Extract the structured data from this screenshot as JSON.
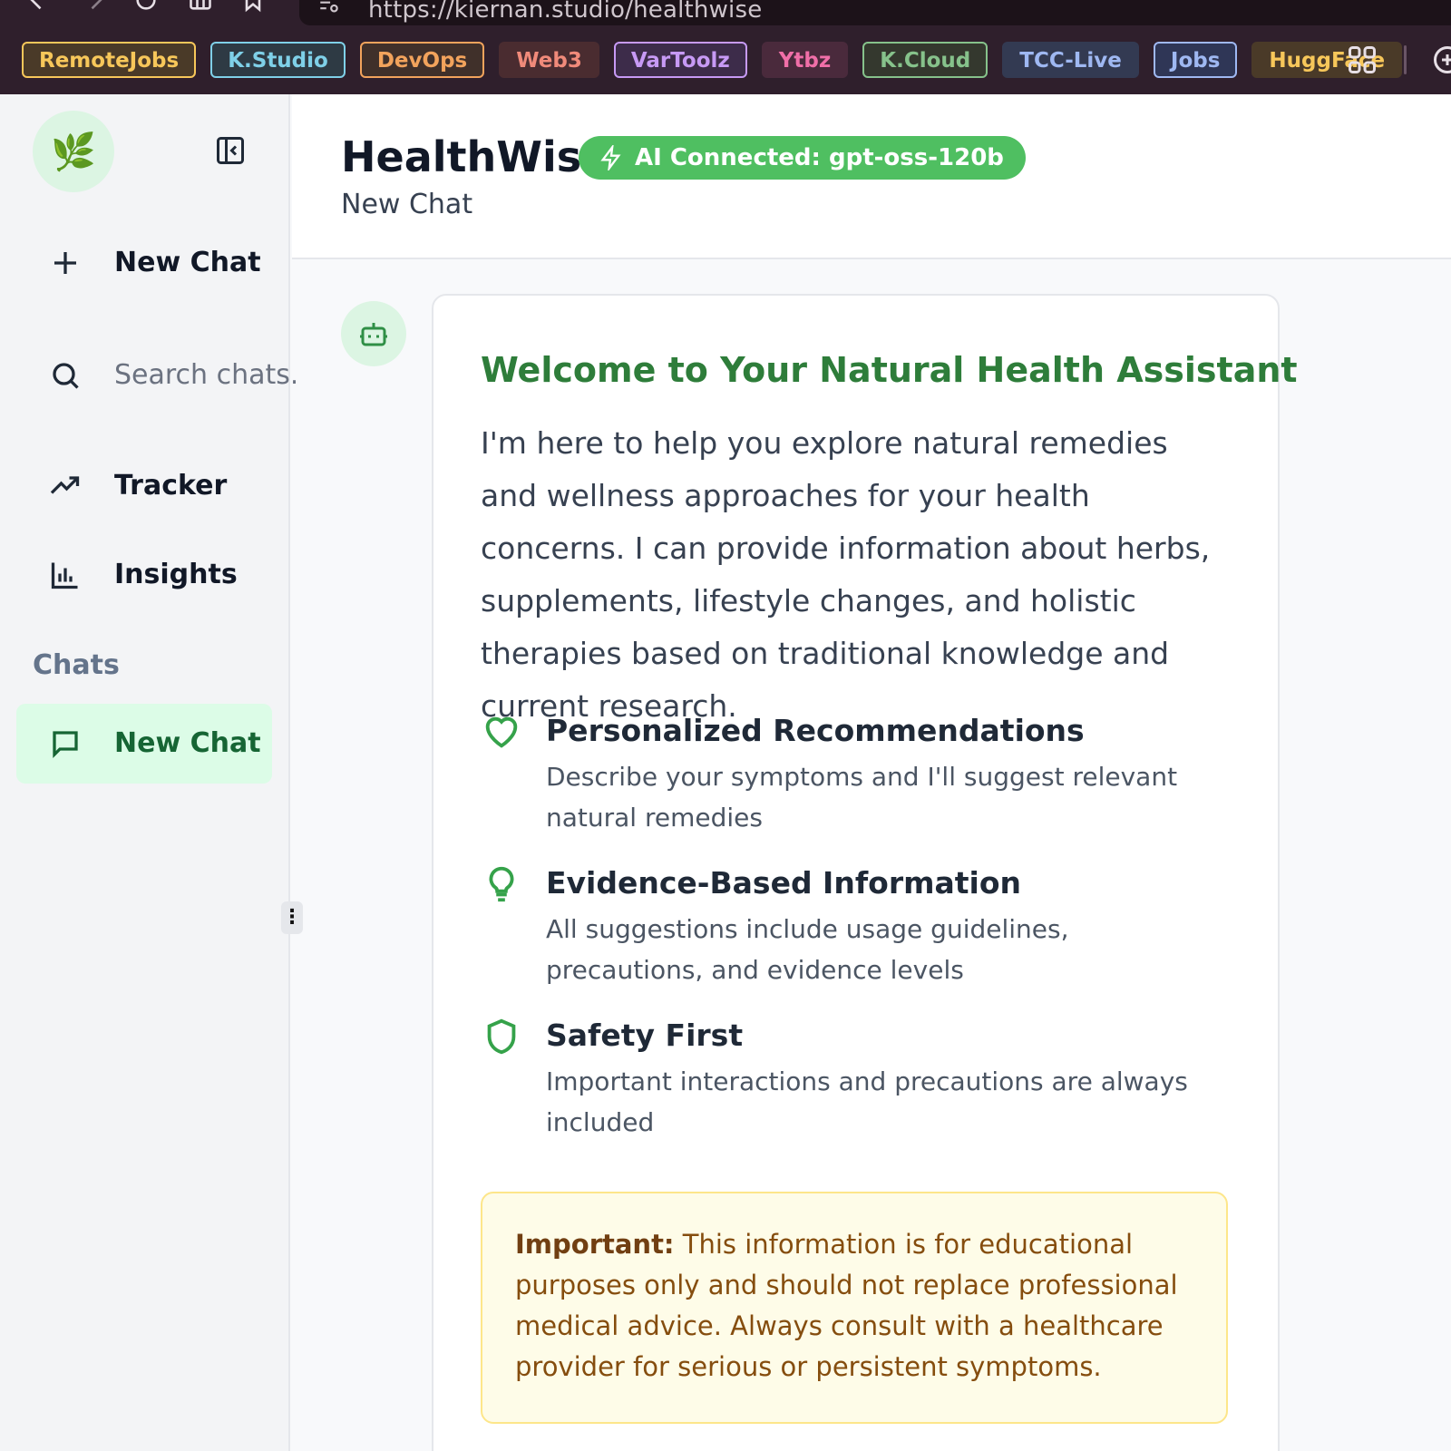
{
  "browser": {
    "url": "https://kiernan.studio/healthwise",
    "bookmarks": [
      {
        "label": "RemoteJobs",
        "color": "#f7c75a",
        "bg": "#4a3a28",
        "border": "#f7c75a"
      },
      {
        "label": "K.Studio",
        "color": "#7fd0e8",
        "bg": "#2e3a44",
        "border": "#7fd0e8"
      },
      {
        "label": "DevOps",
        "color": "#f2a35c",
        "bg": "#40302a",
        "border": "#f2a35c"
      },
      {
        "label": "Web3",
        "color": "#f08a7a",
        "bg": "#4a2c30",
        "border": "#4a2c30"
      },
      {
        "label": "VarToolz",
        "color": "#c79af5",
        "bg": "#3d2c4a",
        "border": "#c79af5"
      },
      {
        "label": "Ytbz",
        "color": "#f06fa8",
        "bg": "#4a2a3c",
        "border": "#4a2a3c"
      },
      {
        "label": "K.Cloud",
        "color": "#86c28b",
        "bg": "#34382e",
        "border": "#86c28b"
      },
      {
        "label": "TCC-Live",
        "color": "#9fb8f2",
        "bg": "#333a52",
        "border": "#333a52"
      },
      {
        "label": "Jobs",
        "color": "#9fb8f2",
        "bg": "#2f3656",
        "border": "#9fb8f2"
      },
      {
        "label": "HuggFace",
        "color": "#f7c75a",
        "bg": "#4a3a28",
        "border": "#4a3a28"
      }
    ]
  },
  "sidebar": {
    "logo_glyph": "🌿",
    "new_chat_label": "New Chat",
    "search_placeholder": "Search chats...",
    "tracker_label": "Tracker",
    "insights_label": "Insights",
    "chats_heading": "Chats",
    "chats": [
      {
        "label": "New Chat",
        "active": true
      }
    ]
  },
  "header": {
    "title": "HealthWise",
    "status_badge": "AI Connected: gpt-oss-120b",
    "subtitle": "New Chat"
  },
  "message": {
    "welcome_title": "Welcome to Your Natural Health Assistant",
    "intro": "I'm here to help you explore natural remedies and wellness approaches for your health concerns. I can provide information about herbs, supplements, lifestyle changes, and holistic therapies based on traditional knowledge and current research.",
    "features": [
      {
        "icon": "heart-icon",
        "title": "Personalized Recommendations",
        "desc": "Describe your symptoms and I'll suggest relevant natural remedies"
      },
      {
        "icon": "lightbulb-icon",
        "title": "Evidence-Based Information",
        "desc": "All suggestions include usage guidelines, precautions, and evidence levels"
      },
      {
        "icon": "shield-icon",
        "title": "Safety First",
        "desc": "Important interactions and precautions are always included"
      }
    ],
    "notice_label": "Important:",
    "notice_text": "This information is for educational purposes only and should not replace professional medical advice. Always consult with a healthcare provider for serious or persistent symptoms."
  },
  "colors": {
    "accent_green": "#2e7d3a",
    "badge_green": "#4fbf61",
    "notice_bg": "#fefce8",
    "chrome_bg": "#2f1f2c"
  }
}
